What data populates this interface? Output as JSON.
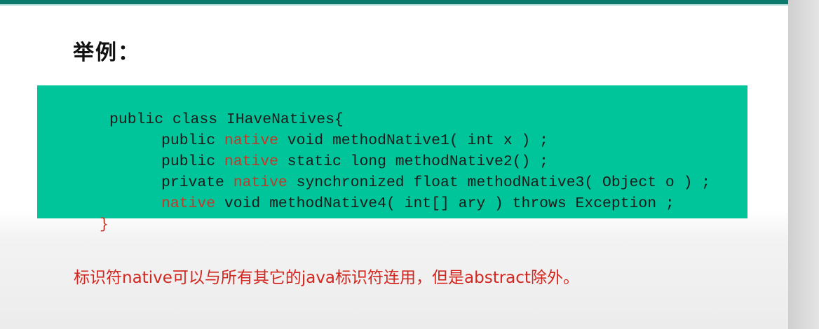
{
  "slide": {
    "heading": "举例：",
    "code_lines": [
      {
        "pre": "public class IHaveNatives{",
        "kw": "",
        "post": ""
      },
      {
        "pre": "public ",
        "kw": "native",
        "post": " void methodNative1( int x ) ;"
      },
      {
        "pre": "public ",
        "kw": "native",
        "post": " static long methodNative2() ;"
      },
      {
        "pre": "private ",
        "kw": "native",
        "post": " synchronized float methodNative3( Object o ) ;"
      },
      {
        "pre": "",
        "kw": "native",
        "post": " void methodNative4( int[] ary ) throws Exception ;"
      },
      {
        "pre": "}",
        "kw": "",
        "post": ""
      }
    ],
    "note": "标识符native可以与所有其它的java标识符连用，但是abstract除外。"
  },
  "colors": {
    "code_background": "#00c59a",
    "keyword": "#c0392b",
    "note_text": "#d2261e",
    "top_rule": "#0e7a6e"
  }
}
